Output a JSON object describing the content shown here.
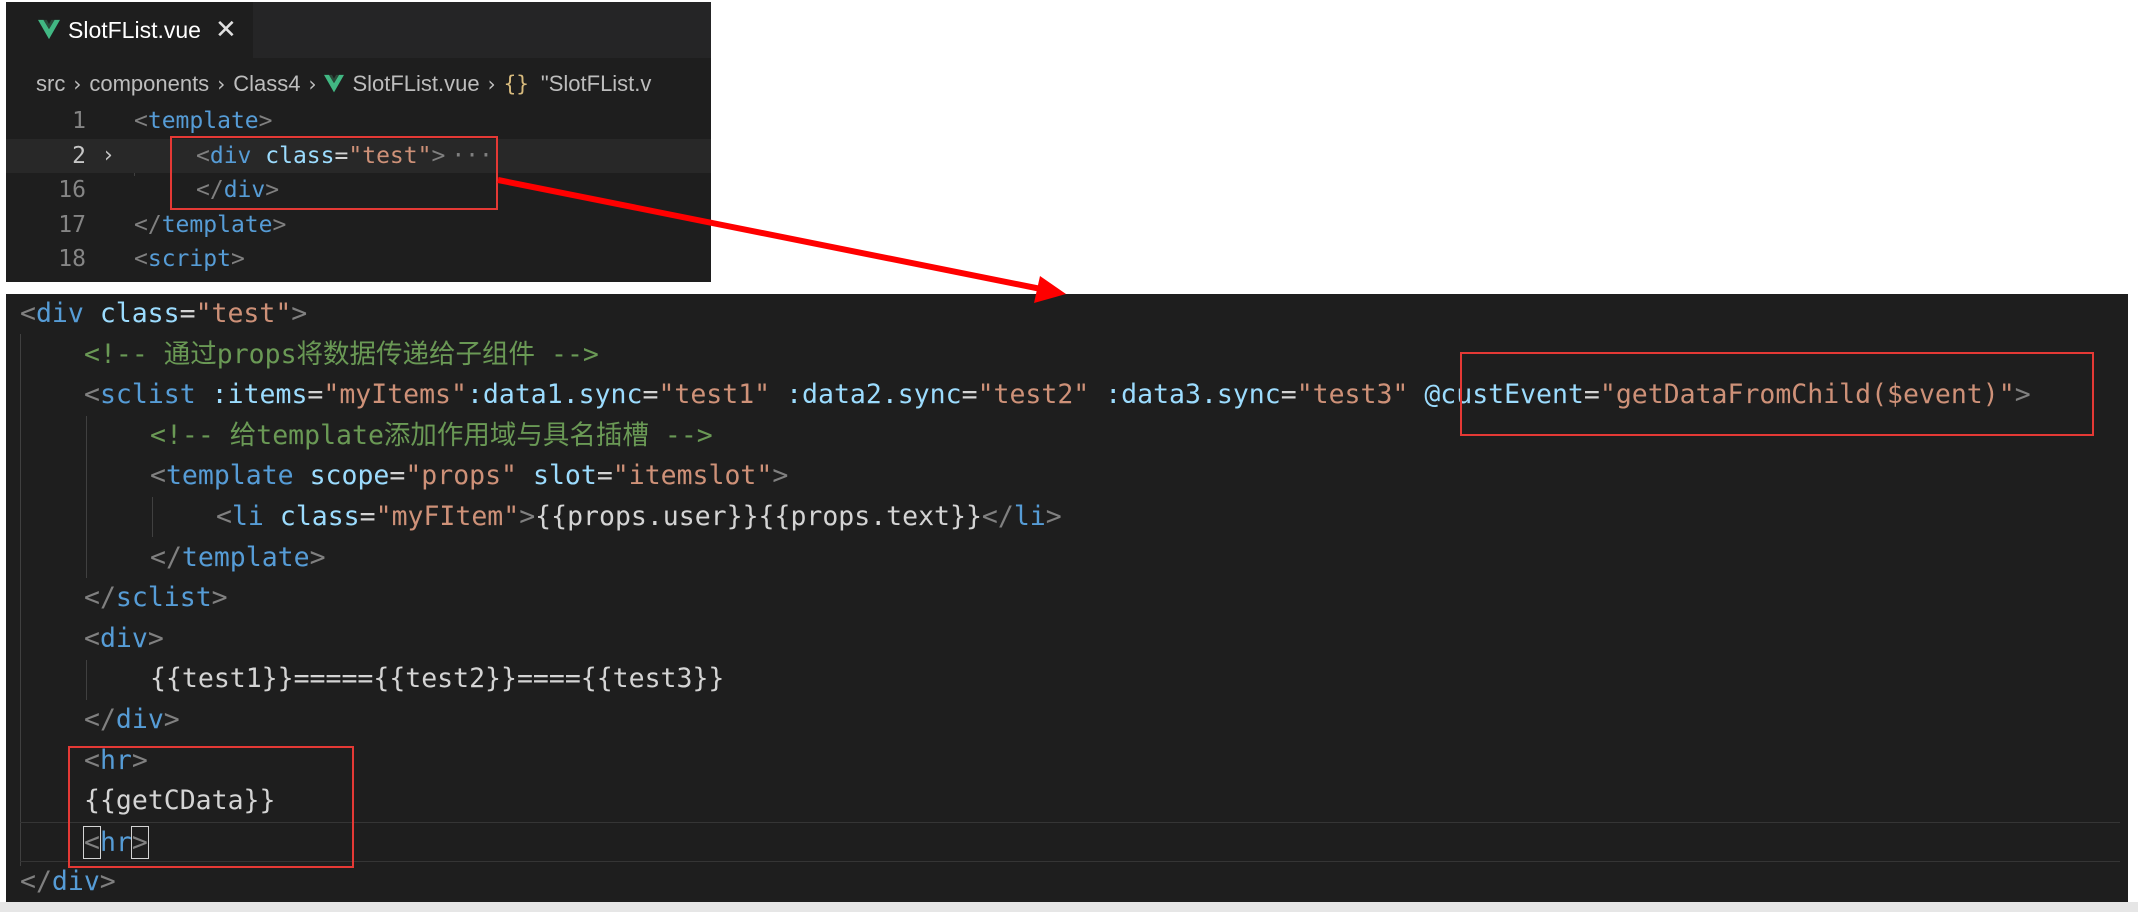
{
  "top_editor": {
    "tab": {
      "icon": "vue-file-icon",
      "label": "SlotFList.vue",
      "close_glyph": "✕"
    },
    "breadcrumb": {
      "items": [
        "src",
        "components",
        "Class4",
        "SlotFList.vue"
      ],
      "symbol_braces": "{}",
      "symbol_label": "\"SlotFList.v",
      "separator": "›"
    },
    "lines": [
      {
        "num": "1",
        "code": "<template>"
      },
      {
        "num": "2",
        "code": "<div class=\"test\">",
        "ellipsis": "···"
      },
      {
        "num": "16",
        "code": "</div>"
      },
      {
        "num": "17",
        "code": "</template>"
      },
      {
        "num": "18",
        "code": "<script>"
      }
    ]
  },
  "bottom_editor": {
    "lines": [
      "<div class=\"test\">",
      "<!-- 通过props将数据传递给子组件 -->",
      "<sclist :items=\"myItems\":data1.sync=\"test1\" :data2.sync=\"test2\" :data3.sync=\"test3\" @custEvent=\"getDataFromChild($event)\">",
      "<!-- 给template添加作用域与具名插槽 -->",
      "<template scope=\"props\" slot=\"itemslot\">",
      "<li class=\"myFItem\">{{props.user}}{{props.text}}</li>",
      "</template>",
      "</sclist>",
      "<div>",
      "{{test1}}====={{test2}}===={{test3}}",
      "</div>",
      "<hr>",
      "{{getCData}}",
      "<hr>",
      "</div>"
    ]
  },
  "colors": {
    "editor_bg": "#1e1e1e",
    "tag": "#569cd6",
    "attribute": "#9cdcfe",
    "string": "#ce9178",
    "comment": "#6a9955",
    "bracket": "#808080",
    "annotation_red": "#e53935"
  }
}
